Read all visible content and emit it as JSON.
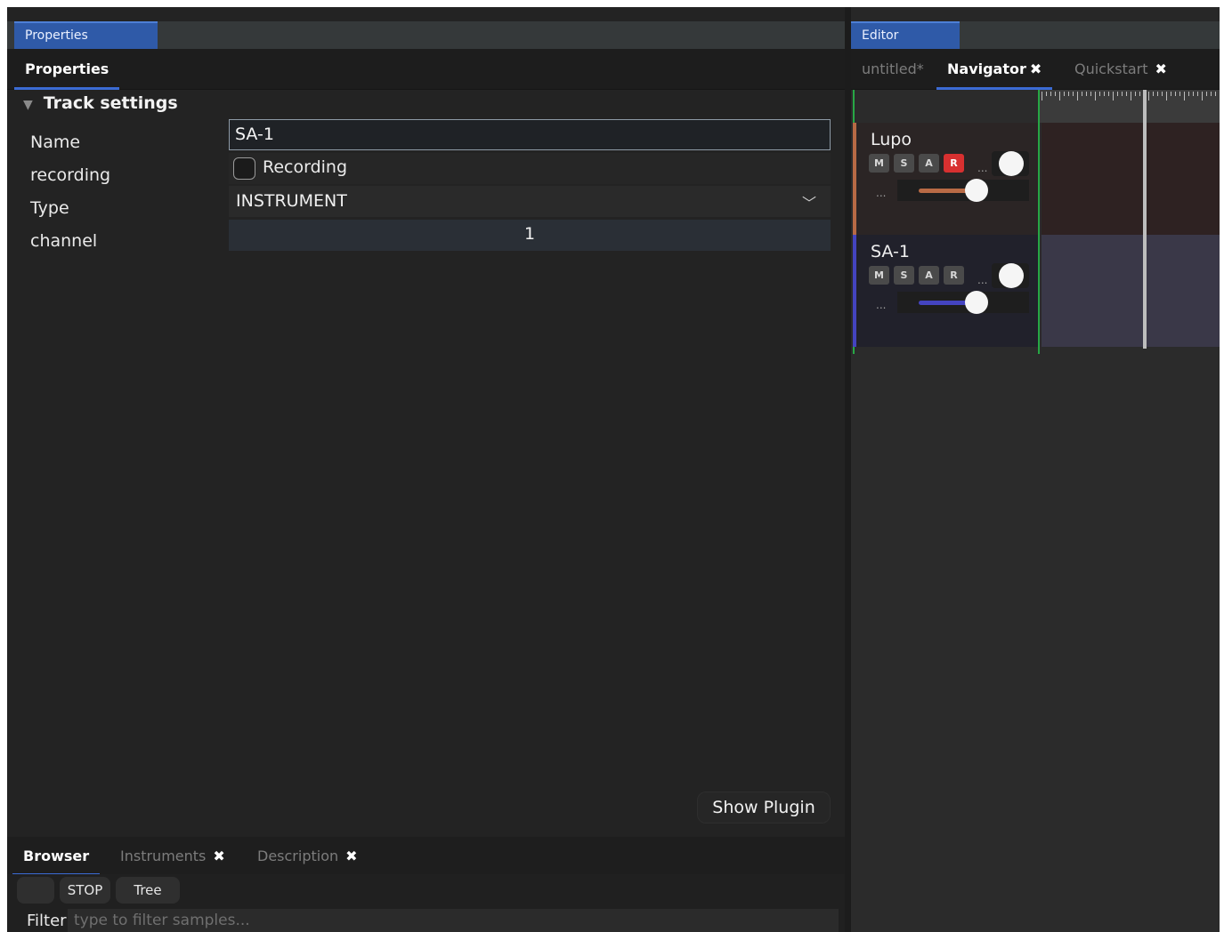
{
  "left_panel": {
    "dock_title": "Properties",
    "tab": "Properties",
    "section": "Track settings",
    "rows": {
      "name_label": "Name",
      "name_value": "SA-1",
      "recording_label": "recording",
      "recording_checkbox_label": "Recording",
      "type_label": "Type",
      "type_value": "INSTRUMENT",
      "channel_label": "channel",
      "channel_value": "1"
    },
    "show_plugin_label": "Show Plugin"
  },
  "browser": {
    "tabs": [
      "Browser",
      "Instruments",
      "Description"
    ],
    "tool_buttons": [
      "",
      "STOP",
      "Tree"
    ],
    "filter_label": "Filter",
    "filter_placeholder": "type to filter samples..."
  },
  "right_panel": {
    "dock_title": "Editor",
    "tabs": [
      "untitled*",
      "Navigator",
      "Quickstart"
    ],
    "tracks": [
      {
        "name": "Lupo",
        "buttons": [
          "M",
          "S",
          "A",
          "R"
        ],
        "record_armed": true,
        "color": "#b86a45",
        "lane_color": "#2e2222"
      },
      {
        "name": "SA-1",
        "buttons": [
          "M",
          "S",
          "A",
          "R"
        ],
        "record_armed": false,
        "color": "#4444c0",
        "lane_color": "#3a3848"
      }
    ],
    "overflow_dots": "...",
    "icons": [
      "close-icon",
      "disclosure-triangle-icon",
      "chevron-down-icon"
    ]
  },
  "colors": {
    "accent_blue": "#2f5aa8",
    "record_red": "#d83030",
    "boundary_green": "#27a745"
  }
}
